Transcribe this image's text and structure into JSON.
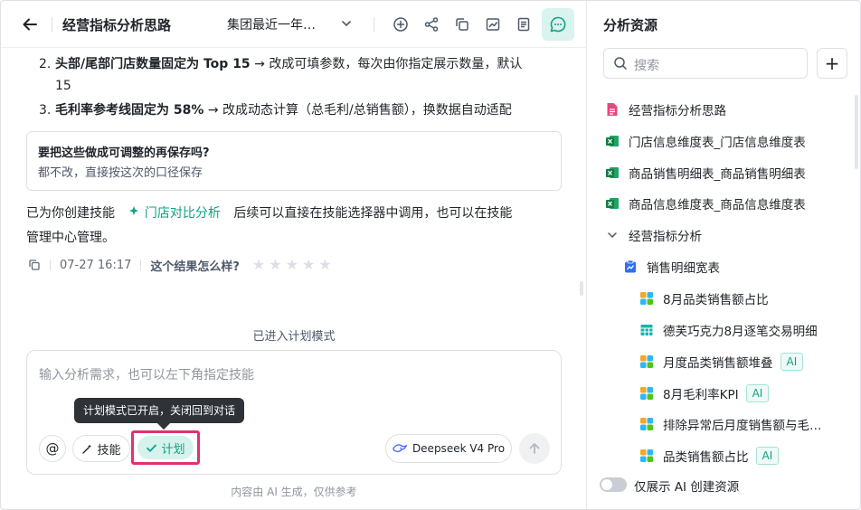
{
  "header": {
    "title": "经营指标分析思路",
    "session_name": "集团最近一年…"
  },
  "messages": {
    "list_items": [
      {
        "num": "2.",
        "bold": "头部/尾部门店数量固定为 Top 15",
        "rest": " → 改成可填参数，每次由你指定展示数量，默认",
        "cont": "15"
      },
      {
        "num": "3.",
        "bold": "毛利率参考线固定为 58%",
        "rest": " → 改成动态计算（总毛利/总销售额），换数据自动适配"
      }
    ],
    "quote": {
      "question": "要把这些做成可调整的再保存吗?",
      "answer": "都不改，直接按这次的口径保存"
    },
    "reply": {
      "prefix": "已为你创建技能",
      "skill_name": "门店对比分析",
      "suffix": "后续可以直接在技能选择器中调用，也可以在技能",
      "line2": "管理中心管理。"
    },
    "meta": {
      "time": "07-27 16:17",
      "rating_prompt": "这个结果怎么样?",
      "stars": 5
    }
  },
  "plan_mode_notice": "已进入计划模式",
  "composer": {
    "placeholder": "输入分析需求，也可以左下角指定技能",
    "tooltip": "计划模式已开启，关闭回到对话",
    "skill_label": "技能",
    "plan_label": "计划",
    "model_label": "Deepseek V4 Pro"
  },
  "footnote": "内容由 AI 生成，仅供参考",
  "sidebar": {
    "title": "分析资源",
    "search_placeholder": "搜索",
    "items": [
      {
        "label": "经营指标分析思路",
        "icon": "doc-icon"
      },
      {
        "label": "门店信息维度表_门店信息维度表",
        "icon": "excel-icon"
      },
      {
        "label": "商品销售明细表_商品销售明细表",
        "icon": "excel-icon"
      },
      {
        "label": "商品信息维度表_商品信息维度表",
        "icon": "excel-icon"
      }
    ],
    "folder": {
      "label": "经营指标分析"
    },
    "subfolder": {
      "label": "销售明细宽表"
    },
    "charts": [
      {
        "label": "8月品类销售额占比",
        "ai": false,
        "icon": "chart-icon"
      },
      {
        "label": "德芙巧克力8月逐笔交易明细",
        "ai": false,
        "icon": "table-icon"
      },
      {
        "label": "月度品类销售额堆叠",
        "ai": true,
        "icon": "chart-icon"
      },
      {
        "label": "8月毛利率KPI",
        "ai": true,
        "icon": "chart-icon"
      },
      {
        "label": "排除异常后月度销售额与毛…",
        "ai": false,
        "icon": "chart-icon"
      },
      {
        "label": "品类销售额占比",
        "ai": true,
        "icon": "chart-icon"
      }
    ],
    "ai_badge": "AI",
    "toggle_label": "仅展示 AI 创建资源"
  },
  "colors": {
    "accent": "#14a085",
    "highlight_border": "#e0336a"
  }
}
